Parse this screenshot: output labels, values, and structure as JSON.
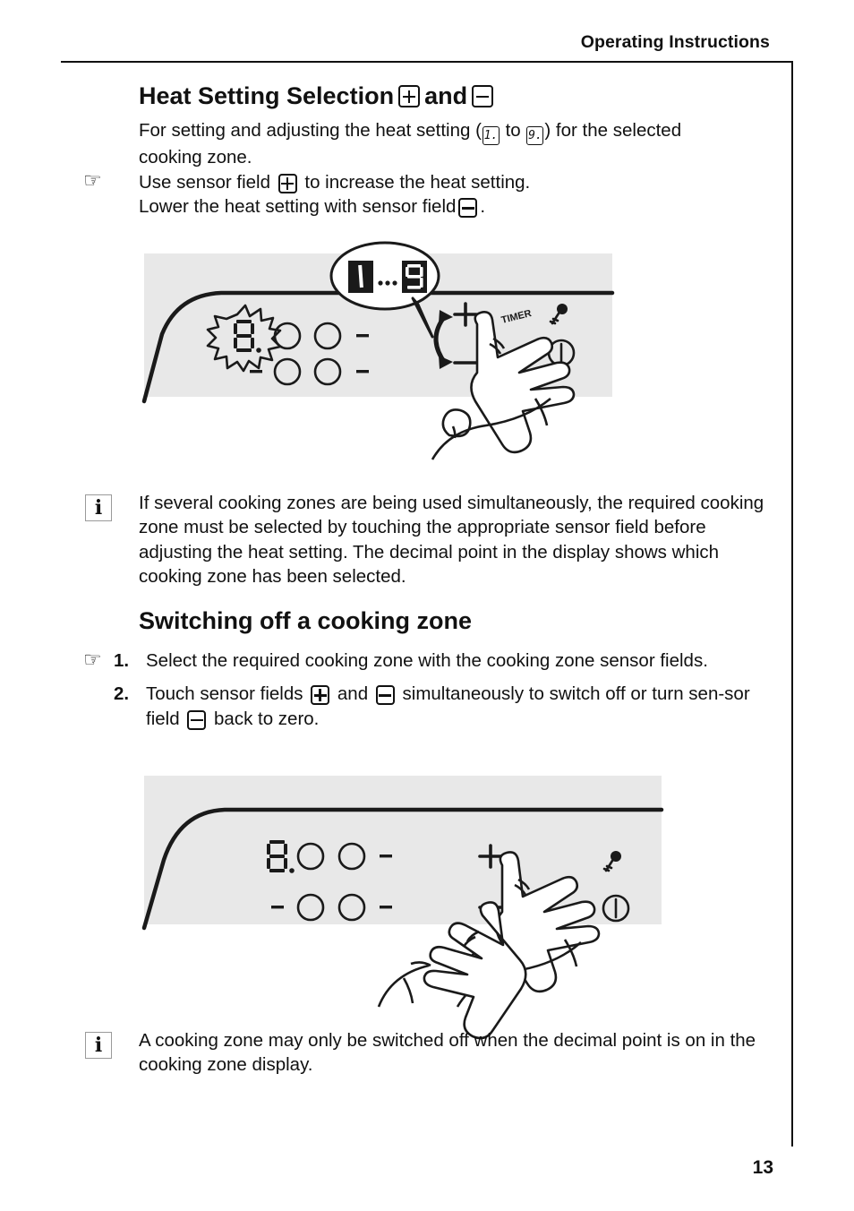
{
  "document": {
    "running_header": "Operating Instructions",
    "page_number": "13"
  },
  "section_1": {
    "title_text_before": "Heat Setting Selection",
    "title_conjunction": "and",
    "intro_part1": "For setting and adjusting the heat setting (",
    "intro_digit_low": "1.",
    "intro_between": " to ",
    "intro_digit_high": "9.",
    "intro_part2": ") for the selected",
    "intro_line2": "cooking zone.",
    "pointer_glyph": "☞",
    "step_line1_a": "Use sensor field",
    "step_line1_b": "to increase the heat setting.",
    "step_line2_a": "Lower the heat setting with sensor field",
    "step_line2_b": "."
  },
  "note_1": {
    "icon": "i",
    "text": "If several cooking zones are being used simultaneously, the required cooking zone must be selected by touching the appropriate sensor field before adjusting the heat setting. The decimal point in the display shows which cooking zone has been selected."
  },
  "section_2": {
    "title": "Switching off a cooking zone",
    "pointer_glyph": "☞",
    "steps": [
      {
        "num": "1.",
        "text_a": "Select the required cooking zone with the cooking zone sensor fields.",
        "text_b": "",
        "text_c": ""
      },
      {
        "num": "2.",
        "text_a": "Touch sensor fields",
        "text_b": "and",
        "text_c": "simultaneously to switch off or turn sen-sor field",
        "text_d": "back to zero."
      }
    ]
  },
  "note_2": {
    "icon": "i",
    "text": "A cooking zone may only be switched off when the decimal point is on in the cooking zone display."
  },
  "illustration_1": {
    "name": "hob-control-panel-increase-heat",
    "callout": {
      "digit_low": "1",
      "ellipsis": "...",
      "digit_high": "9"
    },
    "display_digit": "8.",
    "dash_marks": [
      "-",
      "-",
      "-",
      "-"
    ],
    "plus_label": "+",
    "minus_label": "–",
    "timer_label": "TIMER",
    "key_icon": "key-icon",
    "power_icon": "power-icon",
    "hands": 1
  },
  "illustration_2": {
    "name": "hob-control-panel-switch-off-zone",
    "display_digit": "8.",
    "dash_marks": [
      "-",
      "-",
      "-",
      "-"
    ],
    "plus_label": "+",
    "minus_label": "–",
    "key_icon": "key-icon",
    "power_icon": "power-icon",
    "hands": 2
  },
  "colors": {
    "panel_grey": "#e8e8e8",
    "ink": "#111111",
    "note_border": "#9a9a9a"
  }
}
